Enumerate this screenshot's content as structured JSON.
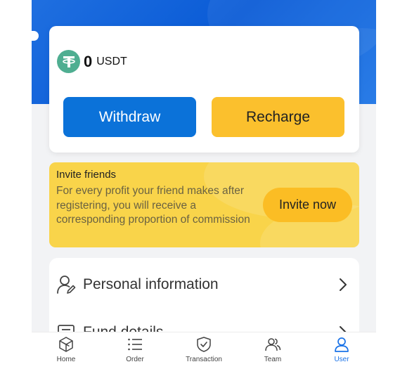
{
  "wallet": {
    "balance": "0",
    "currency": "USDT",
    "withdraw_label": "Withdraw",
    "recharge_label": "Recharge"
  },
  "invite": {
    "title": "Invite friends",
    "description": "For every profit your friend makes after registering, you will receive a corresponding proportion of commission",
    "button_label": "Invite now"
  },
  "menu": {
    "items": [
      {
        "label": "Personal information",
        "icon": "user-edit-icon"
      },
      {
        "label": "Fund details",
        "icon": "ledger-icon"
      }
    ]
  },
  "tabbar": {
    "items": [
      {
        "label": "Home",
        "icon": "cube-icon",
        "active": false
      },
      {
        "label": "Order",
        "icon": "list-icon",
        "active": false
      },
      {
        "label": "Transaction",
        "icon": "shield-check-icon",
        "active": false
      },
      {
        "label": "Team",
        "icon": "team-icon",
        "active": false
      },
      {
        "label": "User",
        "icon": "user-icon",
        "active": true
      }
    ]
  },
  "colors": {
    "primary": "#0b72d9",
    "accent": "#fbc02d",
    "invite_bg": "#f9d44a",
    "tab_active": "#1a73e8"
  }
}
